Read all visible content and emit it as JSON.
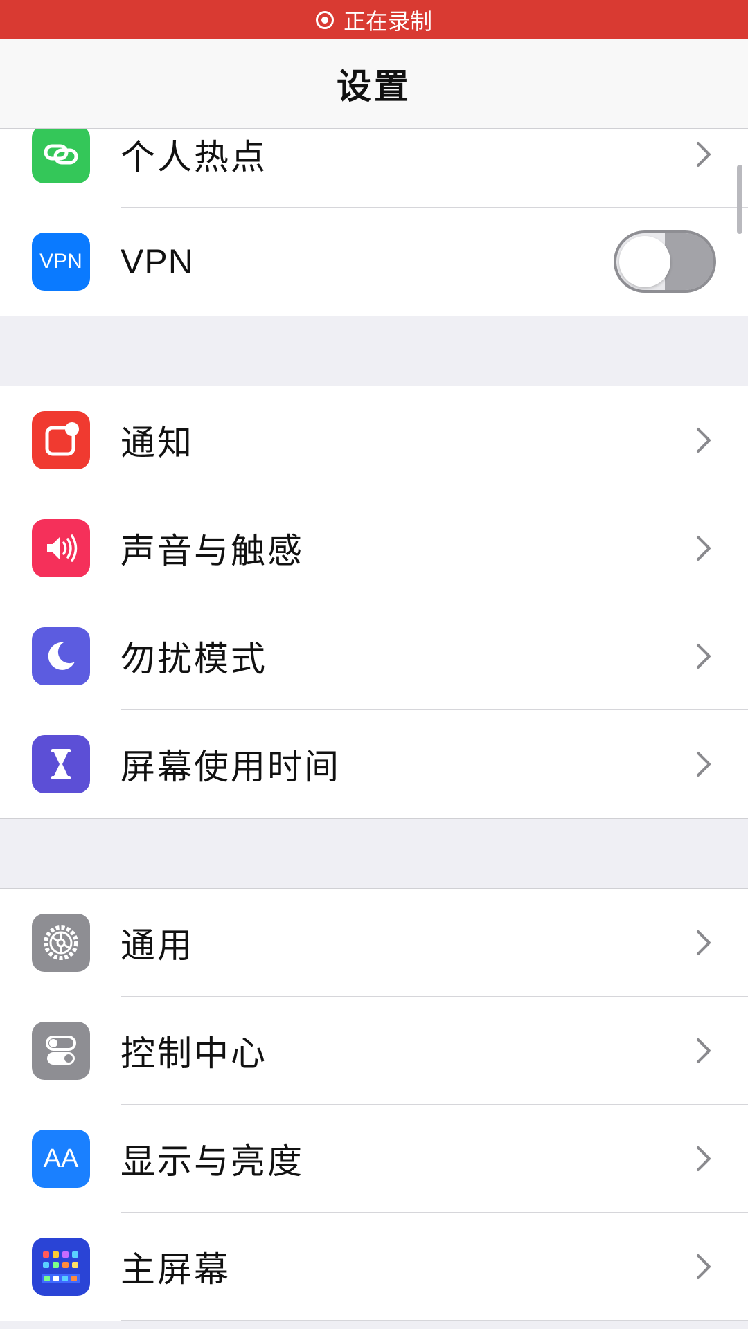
{
  "status_bar": {
    "recording_text": "正在录制",
    "color": "#d93a32"
  },
  "nav": {
    "title": "设置"
  },
  "colors": {
    "hotspot": "#34c759",
    "vpn": "#0a7aff",
    "notifications": "#f03a30",
    "sounds": "#f5305a",
    "focus": "#5c5ce0",
    "screen_time": "#5c4fd6",
    "general": "#8e8e93",
    "control_center": "#8e8e93",
    "display": "#1a80ff",
    "home_screen": "#2a44d6"
  },
  "groups": [
    {
      "items": [
        {
          "label": "个人热点",
          "icon": "link-icon",
          "type": "chevron"
        },
        {
          "label": "VPN",
          "icon": "vpn-icon",
          "icon_text": "VPN",
          "type": "toggle",
          "toggle_on": false
        }
      ]
    },
    {
      "items": [
        {
          "label": "通知",
          "icon": "notification-icon",
          "type": "chevron"
        },
        {
          "label": "声音与触感",
          "icon": "speaker-icon",
          "type": "chevron"
        },
        {
          "label": "勿扰模式",
          "icon": "moon-icon",
          "type": "chevron"
        },
        {
          "label": "屏幕使用时间",
          "icon": "hourglass-icon",
          "type": "chevron"
        }
      ]
    },
    {
      "items": [
        {
          "label": "通用",
          "icon": "gear-icon",
          "type": "chevron"
        },
        {
          "label": "控制中心",
          "icon": "switches-icon",
          "type": "chevron"
        },
        {
          "label": "显示与亮度",
          "icon": "text-size-icon",
          "icon_text": "AA",
          "type": "chevron"
        },
        {
          "label": "主屏幕",
          "icon": "app-grid-icon",
          "type": "chevron"
        }
      ]
    }
  ]
}
